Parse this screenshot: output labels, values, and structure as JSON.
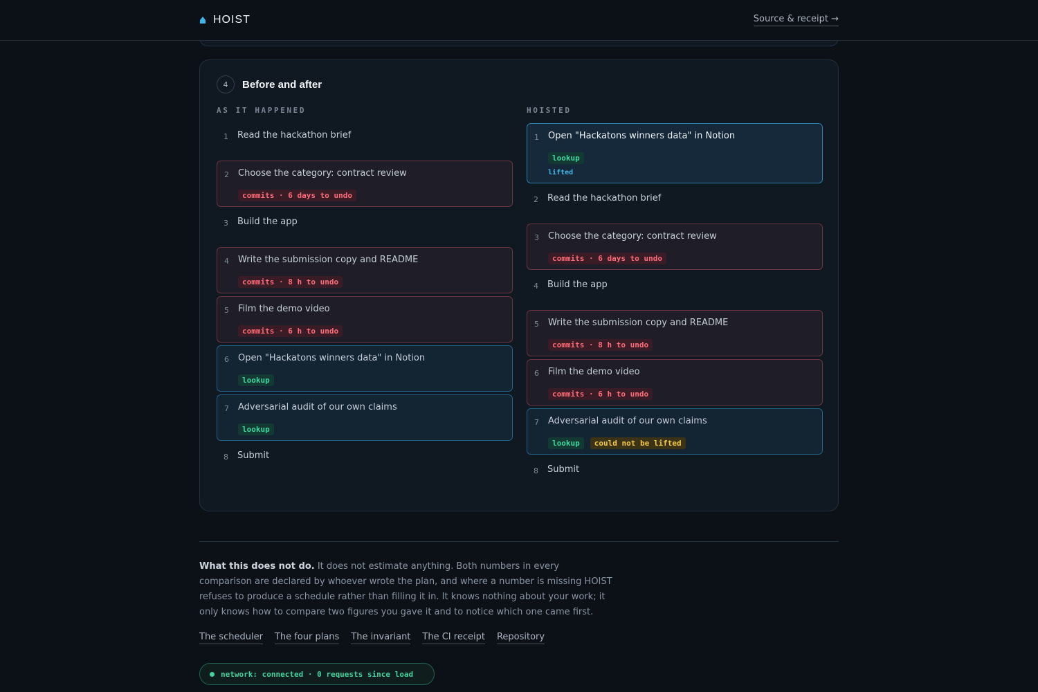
{
  "header": {
    "brand": "HOIST",
    "source_link": "Source & receipt →"
  },
  "section": {
    "number": "4",
    "title": "Before and after"
  },
  "before": {
    "heading": "AS IT HAPPENED",
    "steps": [
      {
        "num": "1",
        "text": "Read the hackathon brief"
      },
      {
        "num": "2",
        "text": "Choose the category: contract review",
        "tag": "commits · 6 days to undo"
      },
      {
        "num": "3",
        "text": "Build the app"
      },
      {
        "num": "4",
        "text": "Write the submission copy and README",
        "tag": "commits · 8 h to undo"
      },
      {
        "num": "5",
        "text": "Film the demo video",
        "tag": "commits · 6 h to undo"
      },
      {
        "num": "6",
        "text": "Open \"Hackatons winners data\" in Notion",
        "tag": "lookup"
      },
      {
        "num": "7",
        "text": "Adversarial audit of our own claims",
        "tag": "lookup"
      },
      {
        "num": "8",
        "text": "Submit"
      }
    ]
  },
  "after": {
    "heading": "HOISTED",
    "steps": [
      {
        "num": "1",
        "text": "Open \"Hackatons winners data\" in Notion",
        "tag": "lookup",
        "note": "lifted"
      },
      {
        "num": "2",
        "text": "Read the hackathon brief"
      },
      {
        "num": "3",
        "text": "Choose the category: contract review",
        "tag": "commits · 6 days to undo"
      },
      {
        "num": "4",
        "text": "Build the app"
      },
      {
        "num": "5",
        "text": "Write the submission copy and README",
        "tag": "commits · 8 h to undo"
      },
      {
        "num": "6",
        "text": "Film the demo video",
        "tag": "commits · 6 h to undo"
      },
      {
        "num": "7",
        "text": "Adversarial audit of our own claims",
        "tag": "lookup",
        "tag2": "could not be lifted"
      },
      {
        "num": "8",
        "text": "Submit"
      }
    ]
  },
  "footer": {
    "disclaimer_lead": "What this does not do.",
    "disclaimer_body": " It does not estimate anything. Both numbers in every comparison are declared by whoever wrote the plan, and where a number is missing HOIST refuses to produce a schedule rather than filling it in. It knows nothing about your work; it only knows how to compare two figures you gave it and to notice which one came first.",
    "links": [
      "The scheduler",
      "The four plans",
      "The invariant",
      "The CI receipt",
      "Repository"
    ],
    "network_status": "network: connected · 0 requests since load"
  }
}
